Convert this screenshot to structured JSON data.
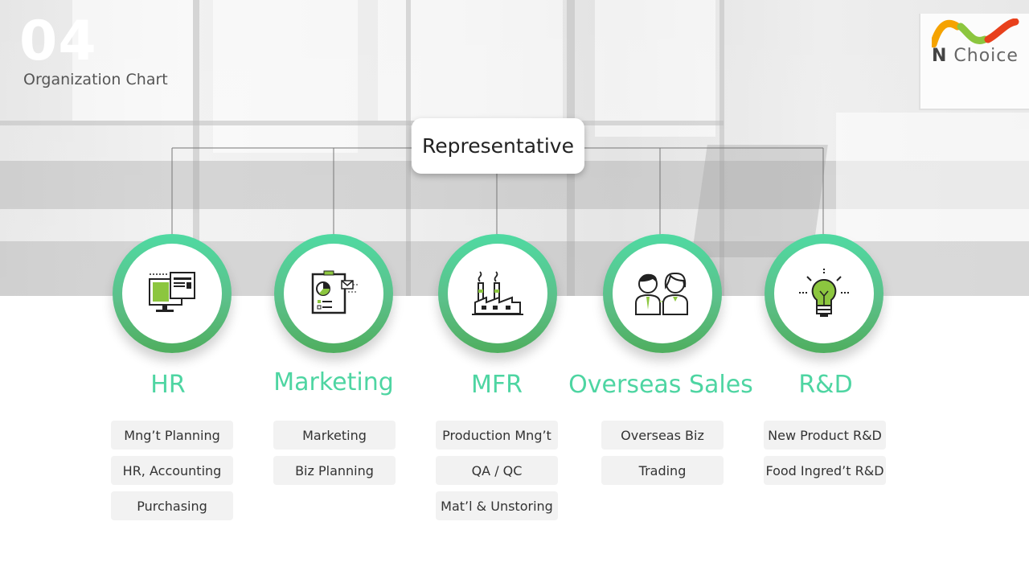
{
  "header": {
    "section_number": "04",
    "section_title": "Organization Chart"
  },
  "logo": {
    "brand_initial": "N",
    "brand_rest": "Choice",
    "colors": [
      "#f5a300",
      "#8cc63f",
      "#e8401c"
    ]
  },
  "chart": {
    "root": "Representative",
    "departments": [
      {
        "name": "HR",
        "icon": "computer-monitor-icon",
        "units": [
          "Mng’t Planning",
          "HR, Accounting",
          "Purchasing"
        ]
      },
      {
        "name": "Marketing",
        "icon": "presentation-board-icon",
        "units": [
          "Marketing",
          "Biz Planning"
        ]
      },
      {
        "name": "MFR",
        "icon": "factory-icon",
        "units": [
          "Production Mng’t",
          "QA / QC",
          "Mat’l & Unstoring"
        ]
      },
      {
        "name": "Overseas Sales",
        "icon": "business-people-icon",
        "units": [
          "Overseas Biz",
          "Trading"
        ]
      },
      {
        "name": "R&D",
        "icon": "lightbulb-icon",
        "units": [
          "New Product R&D",
          "Food Ingred’t R&D"
        ]
      }
    ]
  },
  "colors": {
    "accent_green": "#4ed5a2",
    "icon_green": "#8cc63f",
    "sub_box_bg": "#f2f2f2"
  }
}
